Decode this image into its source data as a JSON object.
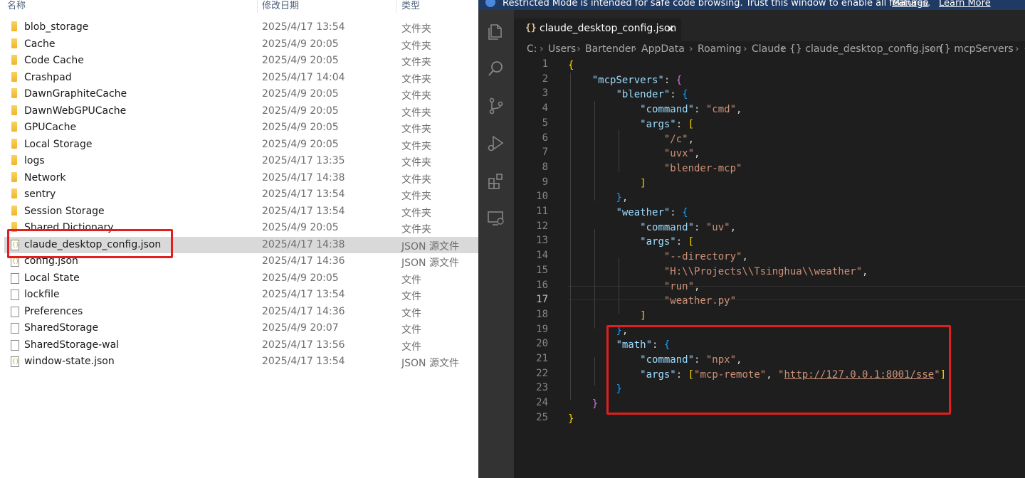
{
  "explorer": {
    "headers": {
      "name": "名称",
      "date": "修改日期",
      "type": "类型"
    },
    "rows": [
      {
        "name": "blob_storage",
        "date": "2025/4/17 13:54",
        "type": "文件夹",
        "icon": "folder-icon"
      },
      {
        "name": "Cache",
        "date": "2025/4/9 20:05",
        "type": "文件夹",
        "icon": "folder-icon"
      },
      {
        "name": "Code Cache",
        "date": "2025/4/9 20:05",
        "type": "文件夹",
        "icon": "folder-icon"
      },
      {
        "name": "Crashpad",
        "date": "2025/4/17 14:04",
        "type": "文件夹",
        "icon": "folder-icon"
      },
      {
        "name": "DawnGraphiteCache",
        "date": "2025/4/9 20:05",
        "type": "文件夹",
        "icon": "folder-icon"
      },
      {
        "name": "DawnWebGPUCache",
        "date": "2025/4/9 20:05",
        "type": "文件夹",
        "icon": "folder-icon"
      },
      {
        "name": "GPUCache",
        "date": "2025/4/9 20:05",
        "type": "文件夹",
        "icon": "folder-icon"
      },
      {
        "name": "Local Storage",
        "date": "2025/4/9 20:05",
        "type": "文件夹",
        "icon": "folder-icon"
      },
      {
        "name": "logs",
        "date": "2025/4/17 13:35",
        "type": "文件夹",
        "icon": "folder-icon"
      },
      {
        "name": "Network",
        "date": "2025/4/17 14:38",
        "type": "文件夹",
        "icon": "folder-icon"
      },
      {
        "name": "sentry",
        "date": "2025/4/17 13:54",
        "type": "文件夹",
        "icon": "folder-icon"
      },
      {
        "name": "Session Storage",
        "date": "2025/4/17 13:54",
        "type": "文件夹",
        "icon": "folder-icon"
      },
      {
        "name": "Shared Dictionary",
        "date": "2025/4/9 20:05",
        "type": "文件夹",
        "icon": "folder-icon"
      },
      {
        "name": "claude_desktop_config.json",
        "date": "2025/4/17 14:38",
        "type": "JSON 源文件",
        "icon": "json-file-icon",
        "selected": true
      },
      {
        "name": "config.json",
        "date": "2025/4/17 14:36",
        "type": "JSON 源文件",
        "icon": "json-file-icon"
      },
      {
        "name": "Local State",
        "date": "2025/4/9 20:05",
        "type": "文件",
        "icon": "file-icon"
      },
      {
        "name": "lockfile",
        "date": "2025/4/17 13:54",
        "type": "文件",
        "icon": "file-icon"
      },
      {
        "name": "Preferences",
        "date": "2025/4/17 14:36",
        "type": "文件",
        "icon": "file-icon"
      },
      {
        "name": "SharedStorage",
        "date": "2025/4/9 20:07",
        "type": "文件",
        "icon": "file-icon"
      },
      {
        "name": "SharedStorage-wal",
        "date": "2025/4/17 13:56",
        "type": "文件",
        "icon": "file-icon"
      },
      {
        "name": "window-state.json",
        "date": "2025/4/17 13:54",
        "type": "JSON 源文件",
        "icon": "json-file-icon"
      }
    ],
    "highlight_color": "#e41e1e"
  },
  "vscode": {
    "banner": {
      "message": "Restricted Mode is intended for safe code browsing. Trust this window to enable all features.",
      "manage": "Manage",
      "learn_more": "Learn More"
    },
    "activity_icons": [
      "explorer-icon",
      "search-icon",
      "source-control-icon",
      "run-debug-icon",
      "extensions-icon",
      "remote-explorer-icon"
    ],
    "tab": {
      "braces": "{}",
      "title": "claude_desktop_config.json",
      "close": "×"
    },
    "breadcrumb": [
      "C:",
      "Users",
      "Bartender",
      "AppData",
      "Roaming",
      "Claude",
      "{} claude_desktop_config.json",
      "{} mcpServers",
      "{}"
    ],
    "breadcrumb_sep": "›",
    "active_line": 17,
    "line_numbers": [
      "1",
      "2",
      "3",
      "4",
      "5",
      "6",
      "7",
      "8",
      "9",
      "10",
      "11",
      "12",
      "13",
      "14",
      "15",
      "16",
      "17",
      "18",
      "19",
      "20",
      "21",
      "22",
      "23",
      "24",
      "25"
    ],
    "code_lines": [
      [
        [
          "b1",
          "{"
        ]
      ],
      [
        [
          "p",
          "    "
        ],
        [
          "k",
          "\"mcpServers\""
        ],
        [
          "p",
          ": "
        ],
        [
          "b2",
          "{"
        ]
      ],
      [
        [
          "p",
          "        "
        ],
        [
          "k",
          "\"blender\""
        ],
        [
          "p",
          ": "
        ],
        [
          "b3",
          "{"
        ]
      ],
      [
        [
          "p",
          "            "
        ],
        [
          "k",
          "\"command\""
        ],
        [
          "p",
          ": "
        ],
        [
          "s",
          "\"cmd\""
        ],
        [
          "p",
          ","
        ]
      ],
      [
        [
          "p",
          "            "
        ],
        [
          "k",
          "\"args\""
        ],
        [
          "p",
          ": "
        ],
        [
          "b1",
          "["
        ]
      ],
      [
        [
          "p",
          "                "
        ],
        [
          "s",
          "\"/c\""
        ],
        [
          "p",
          ","
        ]
      ],
      [
        [
          "p",
          "                "
        ],
        [
          "s",
          "\"uvx\""
        ],
        [
          "p",
          ","
        ]
      ],
      [
        [
          "p",
          "                "
        ],
        [
          "s",
          "\"blender-mcp\""
        ]
      ],
      [
        [
          "p",
          "            "
        ],
        [
          "b1",
          "]"
        ]
      ],
      [
        [
          "p",
          "        "
        ],
        [
          "b3",
          "}"
        ],
        [
          "p",
          ","
        ]
      ],
      [
        [
          "p",
          "        "
        ],
        [
          "k",
          "\"weather\""
        ],
        [
          "p",
          ": "
        ],
        [
          "b3",
          "{"
        ]
      ],
      [
        [
          "p",
          "            "
        ],
        [
          "k",
          "\"command\""
        ],
        [
          "p",
          ": "
        ],
        [
          "s",
          "\"uv\""
        ],
        [
          "p",
          ","
        ]
      ],
      [
        [
          "p",
          "            "
        ],
        [
          "k",
          "\"args\""
        ],
        [
          "p",
          ": "
        ],
        [
          "b1",
          "["
        ]
      ],
      [
        [
          "p",
          "                "
        ],
        [
          "s",
          "\"--directory\""
        ],
        [
          "p",
          ","
        ]
      ],
      [
        [
          "p",
          "                "
        ],
        [
          "s",
          "\"H:\\\\Projects\\\\Tsinghua\\\\weather\""
        ],
        [
          "p",
          ","
        ]
      ],
      [
        [
          "p",
          "                "
        ],
        [
          "s",
          "\"run\""
        ],
        [
          "p",
          ","
        ]
      ],
      [
        [
          "p",
          "                "
        ],
        [
          "s",
          "\"weather.py\""
        ]
      ],
      [
        [
          "p",
          "            "
        ],
        [
          "b1",
          "]"
        ]
      ],
      [
        [
          "p",
          "        "
        ],
        [
          "b3",
          "}"
        ],
        [
          "p",
          ","
        ]
      ],
      [
        [
          "p",
          "        "
        ],
        [
          "k",
          "\"math\""
        ],
        [
          "p",
          ": "
        ],
        [
          "b3",
          "{"
        ]
      ],
      [
        [
          "p",
          "            "
        ],
        [
          "k",
          "\"command\""
        ],
        [
          "p",
          ": "
        ],
        [
          "s",
          "\"npx\""
        ],
        [
          "p",
          ","
        ]
      ],
      [
        [
          "p",
          "            "
        ],
        [
          "k",
          "\"args\""
        ],
        [
          "p",
          ": "
        ],
        [
          "b1",
          "["
        ],
        [
          "s",
          "\"mcp-remote\""
        ],
        [
          "p",
          ", "
        ],
        [
          "s",
          "\""
        ],
        [
          "su",
          "http://127.0.0.1:8001/sse"
        ],
        [
          "s",
          "\""
        ],
        [
          "b1",
          "]"
        ]
      ],
      [
        [
          "p",
          "        "
        ],
        [
          "b3",
          "}"
        ]
      ],
      [
        [
          "p",
          "    "
        ],
        [
          "b2",
          "}"
        ]
      ],
      [
        [
          "b1",
          "}"
        ]
      ]
    ],
    "colors": {
      "background": "#1e1e1e",
      "key": "#9cdcfe",
      "string": "#ce9178",
      "banner": "#1f3a63"
    }
  }
}
